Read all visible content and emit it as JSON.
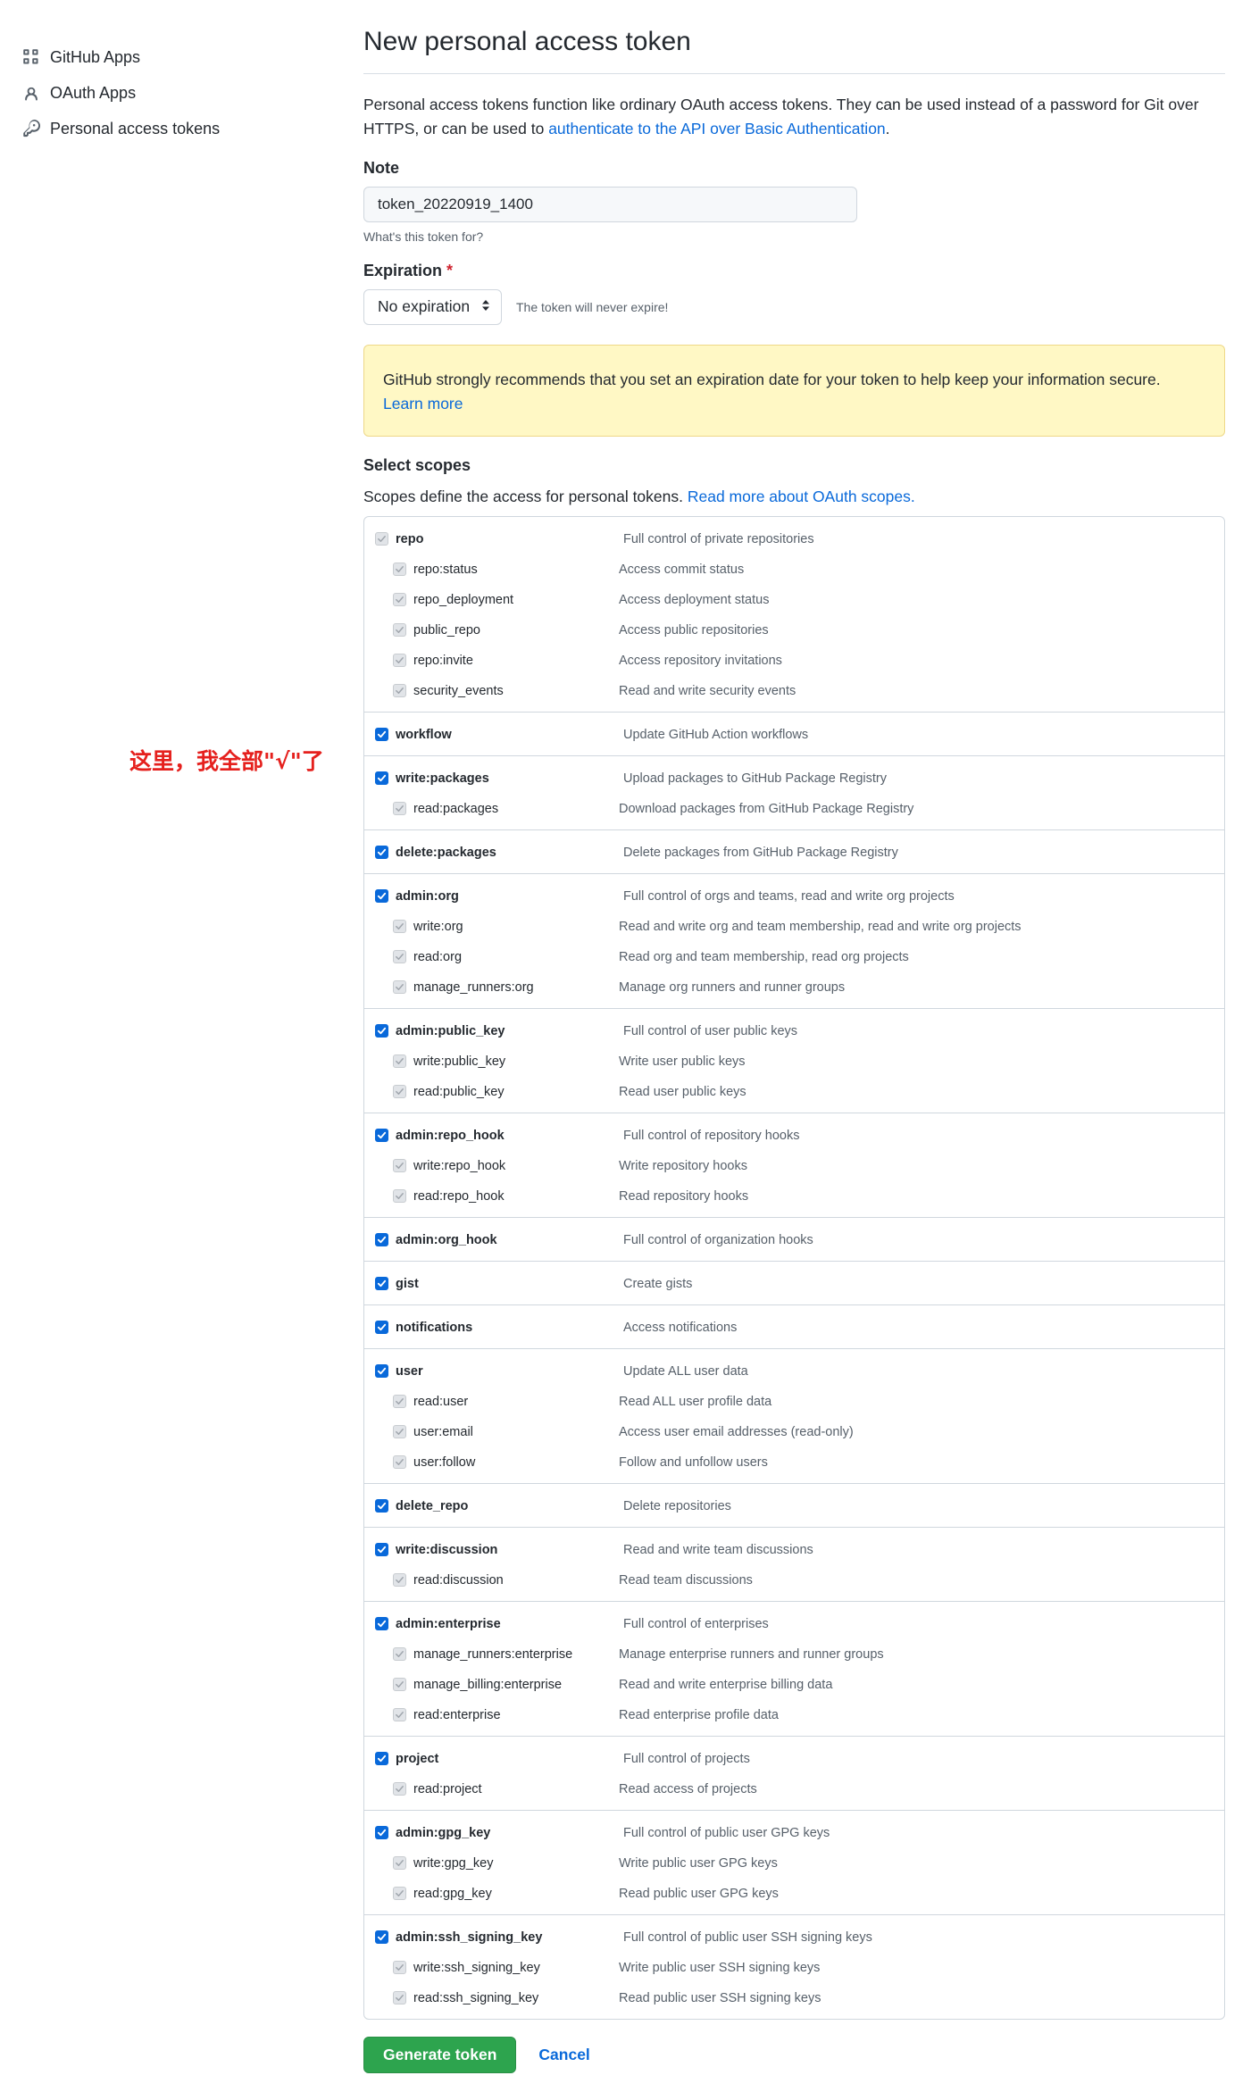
{
  "sidebar": {
    "items": [
      {
        "label": "GitHub Apps",
        "icon": "apps-icon"
      },
      {
        "label": "OAuth Apps",
        "icon": "person-icon"
      },
      {
        "label": "Personal access tokens",
        "icon": "key-icon"
      }
    ]
  },
  "page": {
    "title": "New personal access token",
    "intro_text": "Personal access tokens function like ordinary OAuth access tokens. They can be used instead of a password for Git over HTTPS, or can be used to ",
    "intro_link": "authenticate to the API over Basic Authentication",
    "intro_end": "."
  },
  "note": {
    "label": "Note",
    "value": "token_20220919_1400",
    "hint": "What's this token for?"
  },
  "expiration": {
    "label": "Expiration",
    "required_mark": "*",
    "selected": "No expiration",
    "note": "The token will never expire!"
  },
  "warning": {
    "text": "GitHub strongly recommends that you set an expiration date for your token to help keep your information secure.",
    "link": "Learn more"
  },
  "scopes": {
    "title": "Select scopes",
    "desc": "Scopes define the access for personal tokens. ",
    "desc_link": "Read more about OAuth scopes.",
    "groups": [
      {
        "name": "repo",
        "desc": "Full control of private repositories",
        "checked": true,
        "dim": true,
        "children": [
          {
            "name": "repo:status",
            "desc": "Access commit status"
          },
          {
            "name": "repo_deployment",
            "desc": "Access deployment status"
          },
          {
            "name": "public_repo",
            "desc": "Access public repositories"
          },
          {
            "name": "repo:invite",
            "desc": "Access repository invitations"
          },
          {
            "name": "security_events",
            "desc": "Read and write security events"
          }
        ]
      },
      {
        "name": "workflow",
        "desc": "Update GitHub Action workflows",
        "checked": true,
        "children": []
      },
      {
        "name": "write:packages",
        "desc": "Upload packages to GitHub Package Registry",
        "checked": true,
        "children": [
          {
            "name": "read:packages",
            "desc": "Download packages from GitHub Package Registry"
          }
        ]
      },
      {
        "name": "delete:packages",
        "desc": "Delete packages from GitHub Package Registry",
        "checked": true,
        "children": []
      },
      {
        "name": "admin:org",
        "desc": "Full control of orgs and teams, read and write org projects",
        "checked": true,
        "children": [
          {
            "name": "write:org",
            "desc": "Read and write org and team membership, read and write org projects"
          },
          {
            "name": "read:org",
            "desc": "Read org and team membership, read org projects"
          },
          {
            "name": "manage_runners:org",
            "desc": "Manage org runners and runner groups"
          }
        ]
      },
      {
        "name": "admin:public_key",
        "desc": "Full control of user public keys",
        "checked": true,
        "children": [
          {
            "name": "write:public_key",
            "desc": "Write user public keys"
          },
          {
            "name": "read:public_key",
            "desc": "Read user public keys"
          }
        ]
      },
      {
        "name": "admin:repo_hook",
        "desc": "Full control of repository hooks",
        "checked": true,
        "children": [
          {
            "name": "write:repo_hook",
            "desc": "Write repository hooks"
          },
          {
            "name": "read:repo_hook",
            "desc": "Read repository hooks"
          }
        ]
      },
      {
        "name": "admin:org_hook",
        "desc": "Full control of organization hooks",
        "checked": true,
        "children": []
      },
      {
        "name": "gist",
        "desc": "Create gists",
        "checked": true,
        "children": []
      },
      {
        "name": "notifications",
        "desc": "Access notifications",
        "checked": true,
        "children": []
      },
      {
        "name": "user",
        "desc": "Update ALL user data",
        "checked": true,
        "children": [
          {
            "name": "read:user",
            "desc": "Read ALL user profile data"
          },
          {
            "name": "user:email",
            "desc": "Access user email addresses (read-only)"
          },
          {
            "name": "user:follow",
            "desc": "Follow and unfollow users"
          }
        ]
      },
      {
        "name": "delete_repo",
        "desc": "Delete repositories",
        "checked": true,
        "children": []
      },
      {
        "name": "write:discussion",
        "desc": "Read and write team discussions",
        "checked": true,
        "children": [
          {
            "name": "read:discussion",
            "desc": "Read team discussions"
          }
        ]
      },
      {
        "name": "admin:enterprise",
        "desc": "Full control of enterprises",
        "checked": true,
        "children": [
          {
            "name": "manage_runners:enterprise",
            "desc": "Manage enterprise runners and runner groups"
          },
          {
            "name": "manage_billing:enterprise",
            "desc": "Read and write enterprise billing data"
          },
          {
            "name": "read:enterprise",
            "desc": "Read enterprise profile data"
          }
        ]
      },
      {
        "name": "project",
        "desc": "Full control of projects",
        "checked": true,
        "children": [
          {
            "name": "read:project",
            "desc": "Read access of projects"
          }
        ]
      },
      {
        "name": "admin:gpg_key",
        "desc": "Full control of public user GPG keys",
        "checked": true,
        "children": [
          {
            "name": "write:gpg_key",
            "desc": "Write public user GPG keys"
          },
          {
            "name": "read:gpg_key",
            "desc": "Read public user GPG keys"
          }
        ]
      },
      {
        "name": "admin:ssh_signing_key",
        "desc": "Full control of public user SSH signing keys",
        "checked": true,
        "children": [
          {
            "name": "write:ssh_signing_key",
            "desc": "Write public user SSH signing keys"
          },
          {
            "name": "read:ssh_signing_key",
            "desc": "Read public user SSH signing keys"
          }
        ]
      }
    ]
  },
  "actions": {
    "generate": "Generate token",
    "cancel": "Cancel"
  },
  "annotation": "这里，我全部\"√\"了",
  "colors": {
    "accent": "#0969da",
    "primary_button": "#2da44e",
    "warning_bg": "#fff8c5",
    "annotation": "#e5201d"
  }
}
